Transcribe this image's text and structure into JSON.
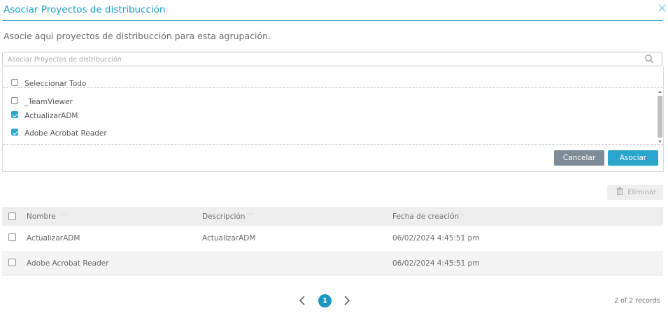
{
  "dialog": {
    "title": "Asociar Proyectos de distribucción",
    "close_symbol": "✕",
    "subtitle": "Asocie aqui proyectos de distribucción para esta agrupación."
  },
  "search": {
    "placeholder": "Asociar Proyectos de distribucción",
    "value": ""
  },
  "dropdown": {
    "select_all_label": "Seleccionar Todo",
    "select_all_checked": false,
    "options": [
      {
        "label": "_TeamViewer",
        "checked": false
      },
      {
        "label": "ActualizarADM",
        "checked": true
      },
      {
        "label": "Adobe Acrobat Reader",
        "checked": true
      }
    ],
    "cancel_label": "Cancelar",
    "associate_label": "Asociar"
  },
  "toolbar": {
    "delete_label": "Eliminar"
  },
  "table": {
    "columns": [
      "Nombre",
      "Descripción",
      "Fecha de creación"
    ],
    "rows": [
      {
        "name": "ActualizarADM",
        "description": "ActualizarADM",
        "created": "06/02/2024 4:45:51 pm"
      },
      {
        "name": "Adobe Acrobat Reader",
        "description": "",
        "created": "06/02/2024 4:45:51 pm"
      }
    ]
  },
  "pagination": {
    "current_page": "1",
    "records_text": "2 of 2 records"
  },
  "colors": {
    "accent": "#1f9bc3",
    "cancel": "#7e8c97",
    "primary_button": "#2aa5cc",
    "header_bg": "#eeeeee"
  },
  "icons": [
    "close-icon",
    "search-icon",
    "trash-icon",
    "sort-chevron-icon",
    "chevron-left-icon",
    "chevron-right-icon"
  ]
}
